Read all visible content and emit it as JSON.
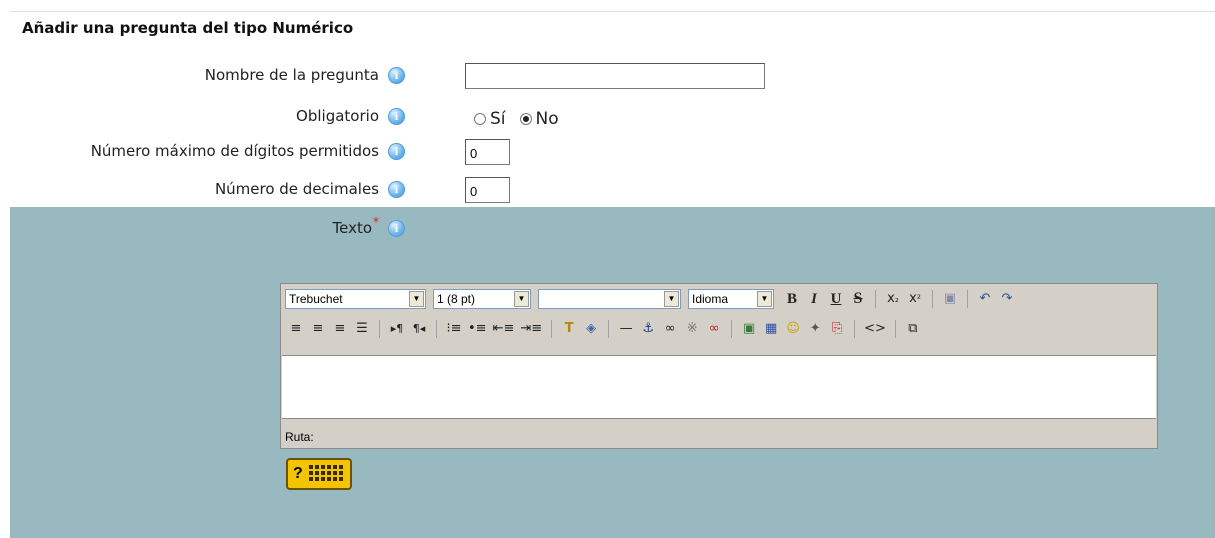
{
  "heading": "Añadir una pregunta del tipo Numérico",
  "fields": {
    "name_label": "Nombre de la pregunta",
    "name_value": "",
    "required_label": "Obligatorio",
    "required_yes": "Sí",
    "required_no": "No",
    "required_selected": "No",
    "maxdigits_label": "Número máximo de dígitos permitidos",
    "maxdigits_value": "0",
    "decimals_label": "Número de decimales",
    "decimals_value": "0",
    "text_label": "Texto",
    "required_marker": "*"
  },
  "editor": {
    "font_family": "Trebuchet",
    "font_size": "1 (8 pt)",
    "format": "",
    "language": "Idioma",
    "path_label": "Ruta:",
    "content": ""
  },
  "colors": {
    "panel_bg": "#99b9c0",
    "toolbar_bg": "#d4d0c8",
    "help_button": "#f5c400"
  },
  "icons": {
    "info": "info-icon",
    "help": "help-keyboard-icon"
  }
}
